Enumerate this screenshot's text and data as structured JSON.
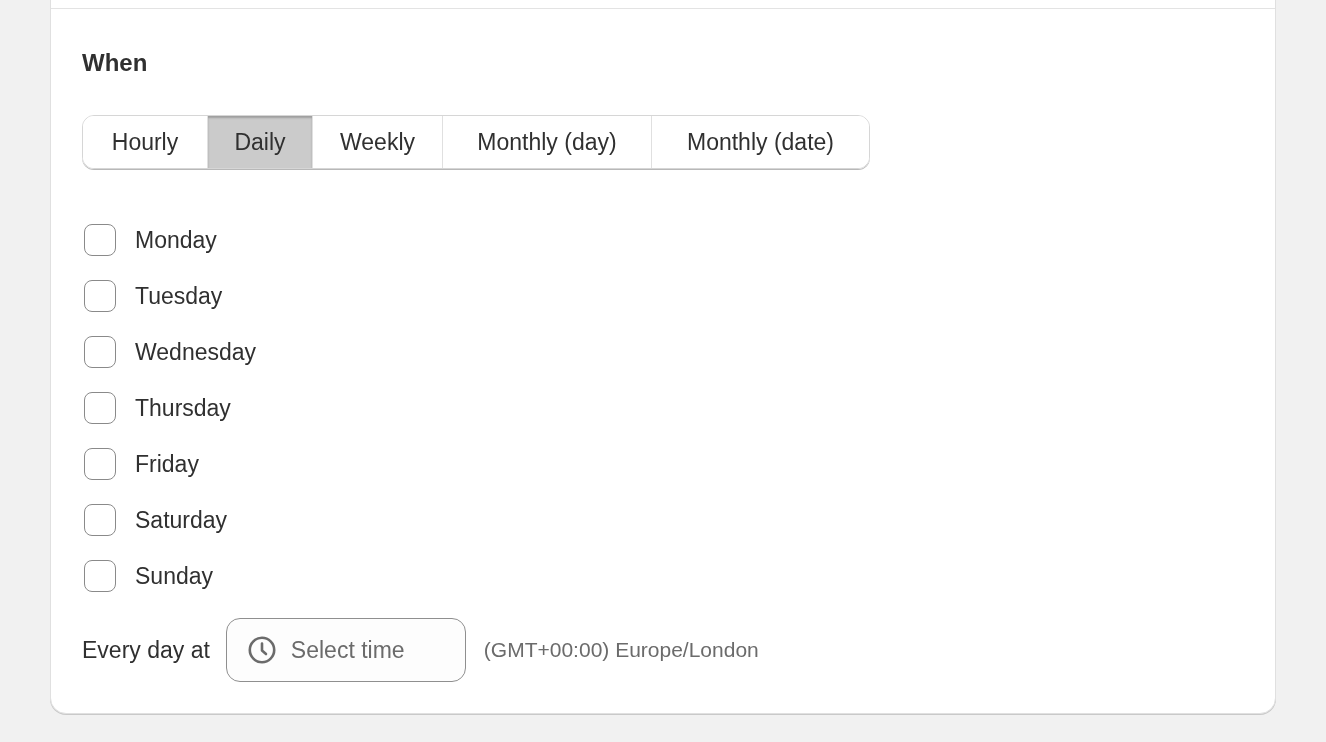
{
  "section": {
    "title": "When"
  },
  "frequency_tabs": [
    {
      "label": "Hourly",
      "selected": false
    },
    {
      "label": "Daily",
      "selected": true
    },
    {
      "label": "Weekly",
      "selected": false
    },
    {
      "label": "Monthly (day)",
      "selected": false
    },
    {
      "label": "Monthly (date)",
      "selected": false
    }
  ],
  "days": [
    {
      "label": "Monday",
      "checked": false
    },
    {
      "label": "Tuesday",
      "checked": false
    },
    {
      "label": "Wednesday",
      "checked": false
    },
    {
      "label": "Thursday",
      "checked": false
    },
    {
      "label": "Friday",
      "checked": false
    },
    {
      "label": "Saturday",
      "checked": false
    },
    {
      "label": "Sunday",
      "checked": false
    }
  ],
  "time_row": {
    "label": "Every day at",
    "time_field": {
      "placeholder": "Select time"
    },
    "timezone": "(GMT+00:00) Europe/London"
  }
}
